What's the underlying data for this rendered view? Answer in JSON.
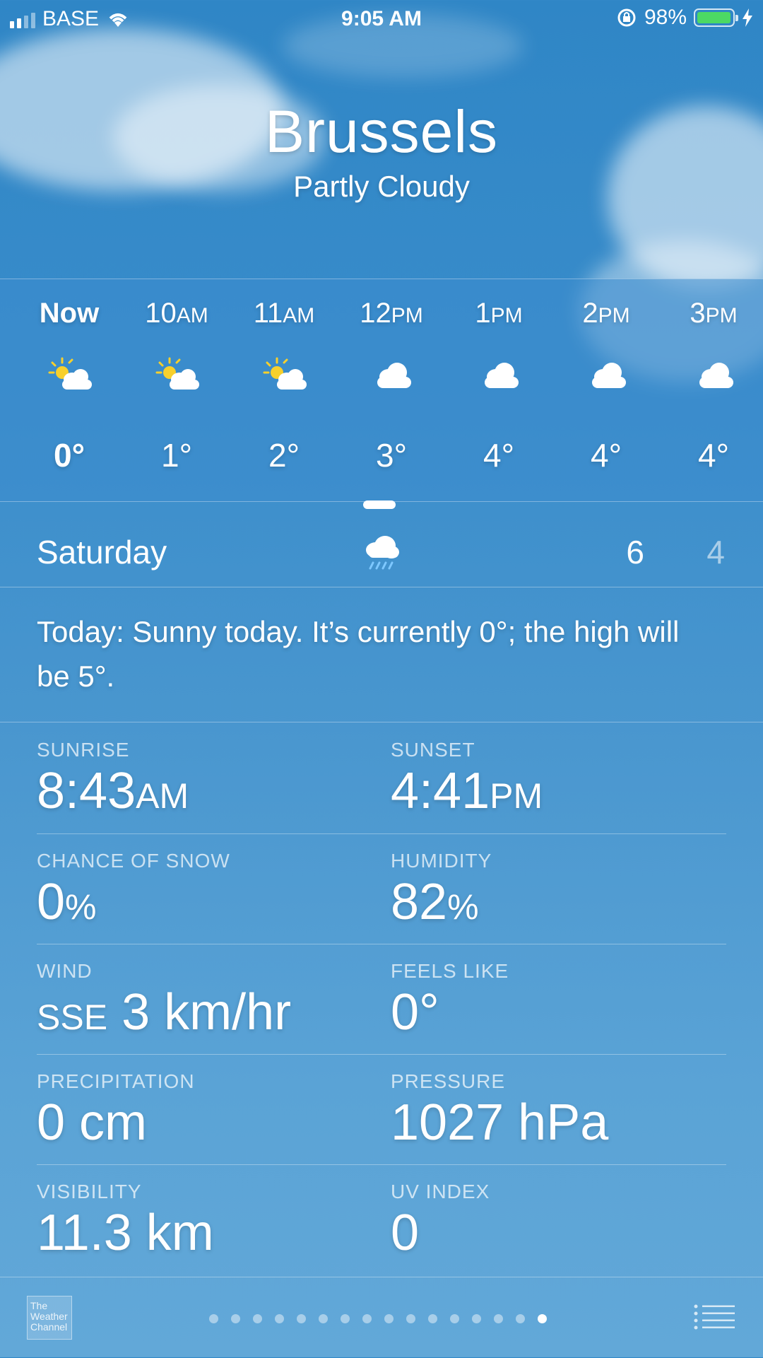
{
  "status_bar": {
    "carrier": "BASE",
    "time": "9:05 AM",
    "battery_percent": "98%",
    "battery_level": 0.98,
    "battery_color": "#4cd964"
  },
  "location": {
    "city": "Brussels",
    "condition": "Partly Cloudy"
  },
  "hourly": [
    {
      "time": "Now",
      "suffix": "",
      "icon": "sun-cloud-icon",
      "temp": "0°"
    },
    {
      "time": "10",
      "suffix": "AM",
      "icon": "sun-cloud-icon",
      "temp": "1°"
    },
    {
      "time": "11",
      "suffix": "AM",
      "icon": "sun-cloud-icon",
      "temp": "2°"
    },
    {
      "time": "12",
      "suffix": "PM",
      "icon": "cloud-icon",
      "temp": "3°"
    },
    {
      "time": "1",
      "suffix": "PM",
      "icon": "cloud-icon",
      "temp": "4°"
    },
    {
      "time": "2",
      "suffix": "PM",
      "icon": "cloud-icon",
      "temp": "4°"
    },
    {
      "time": "3",
      "suffix": "PM",
      "icon": "cloud-icon",
      "temp": "4°"
    }
  ],
  "daily": [
    {
      "day": "Saturday",
      "icon": "rain-cloud-icon",
      "high": "6",
      "low": "4"
    }
  ],
  "summary": "Today: Sunny today. It’s currently 0°; the high will be 5°.",
  "details": {
    "sunrise": {
      "label": "SUNRISE",
      "value": "8:43",
      "suffix": "AM"
    },
    "sunset": {
      "label": "SUNSET",
      "value": "4:41",
      "suffix": "PM"
    },
    "chance_of_snow": {
      "label": "CHANCE OF SNOW",
      "value": "0",
      "suffix": "%"
    },
    "humidity": {
      "label": "HUMIDITY",
      "value": "82",
      "suffix": "%"
    },
    "wind": {
      "label": "WIND",
      "prefix": "SSE",
      "value": "3 km/hr"
    },
    "feels_like": {
      "label": "FEELS LIKE",
      "value": "0°"
    },
    "precipitation": {
      "label": "PRECIPITATION",
      "value": "0 cm"
    },
    "pressure": {
      "label": "PRESSURE",
      "value": "1027 hPa"
    },
    "visibility": {
      "label": "VISIBILITY",
      "value": "11.3 km"
    },
    "uv_index": {
      "label": "UV INDEX",
      "value": "0"
    }
  },
  "footer": {
    "logo_text": "The Weather Channel",
    "page_count": 16,
    "active_page": 16
  }
}
